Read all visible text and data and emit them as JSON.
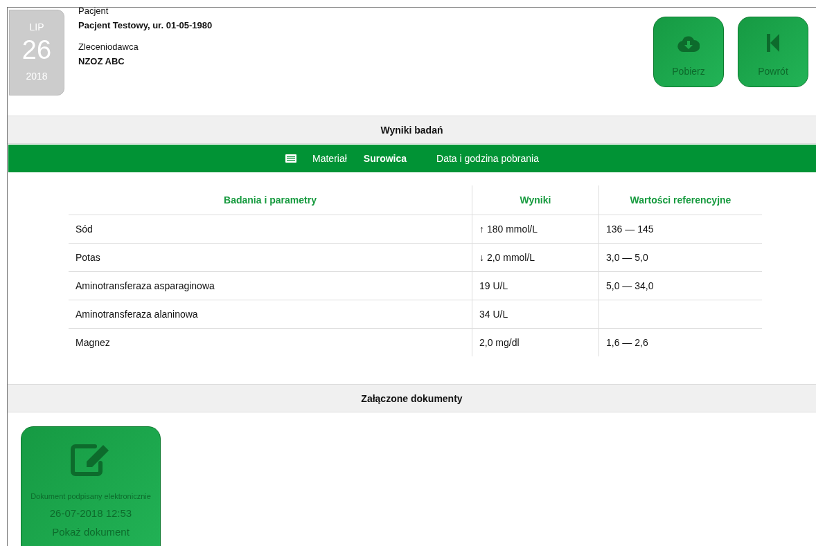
{
  "date": {
    "month": "LIP",
    "day": "26",
    "year": "2018"
  },
  "patient": {
    "label": "Pacjent",
    "value": "Pacjent Testowy, ur. 01-05-1980"
  },
  "orderer": {
    "label": "Zleceniodawca",
    "value": "NZOZ ABC"
  },
  "actions": [
    {
      "kind": "download",
      "label": "Pobierz"
    },
    {
      "kind": "back",
      "label": "Powrót"
    }
  ],
  "results_section": {
    "title": "Wyniki badań"
  },
  "info_bar": {
    "material_label": "Materiał",
    "material_value": "Surowica",
    "date_label": "Data i godzina pobrania"
  },
  "table": {
    "columns": [
      "Badania i parametry",
      "Wyniki",
      "Wartości referencyjne"
    ],
    "rows": [
      [
        "Sód",
        "↑ 180 mmol/L",
        "136 — 145"
      ],
      [
        "Potas",
        "↓ 2,0 mmol/L",
        "3,0 — 5,0"
      ],
      [
        "Aminotransferaza asparaginowa",
        "19 U/L",
        "5,0 — 34,0"
      ],
      [
        "Aminotransferaza alaninowa",
        "34 U/L",
        ""
      ],
      [
        "Magnez",
        "2,0 mg/dl",
        "1,6 — 2,6"
      ]
    ]
  },
  "documents_section": {
    "title": "Załączone dokumenty"
  },
  "documents": [
    {
      "title": "Dokument podpisany elektronicznie",
      "date": "26-07-2018 12:53",
      "link": "Pokaż dokument"
    }
  ]
}
